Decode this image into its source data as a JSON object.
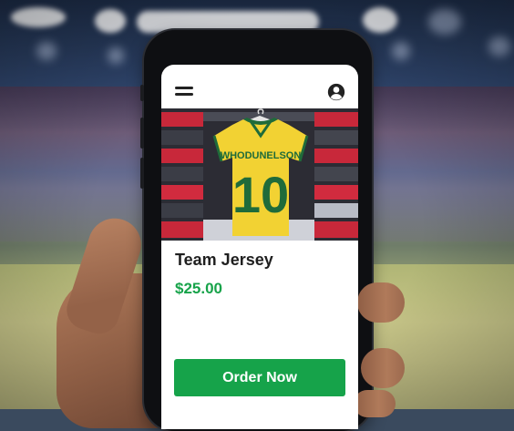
{
  "app": {
    "header": {
      "menu_icon": "hamburger-menu-icon",
      "account_icon": "account-circle-icon"
    },
    "product": {
      "image_icon": "jersey-photo",
      "jersey_name": "WHODUNELSON",
      "jersey_number": "10",
      "title": "Team Jersey",
      "price": "$25.00"
    },
    "actions": {
      "order_label": "Order Now"
    }
  },
  "colors": {
    "accent": "#16a34a",
    "price": "#17a34a",
    "jersey_yellow": "#f2d233",
    "jersey_green": "#1f6b3a"
  }
}
